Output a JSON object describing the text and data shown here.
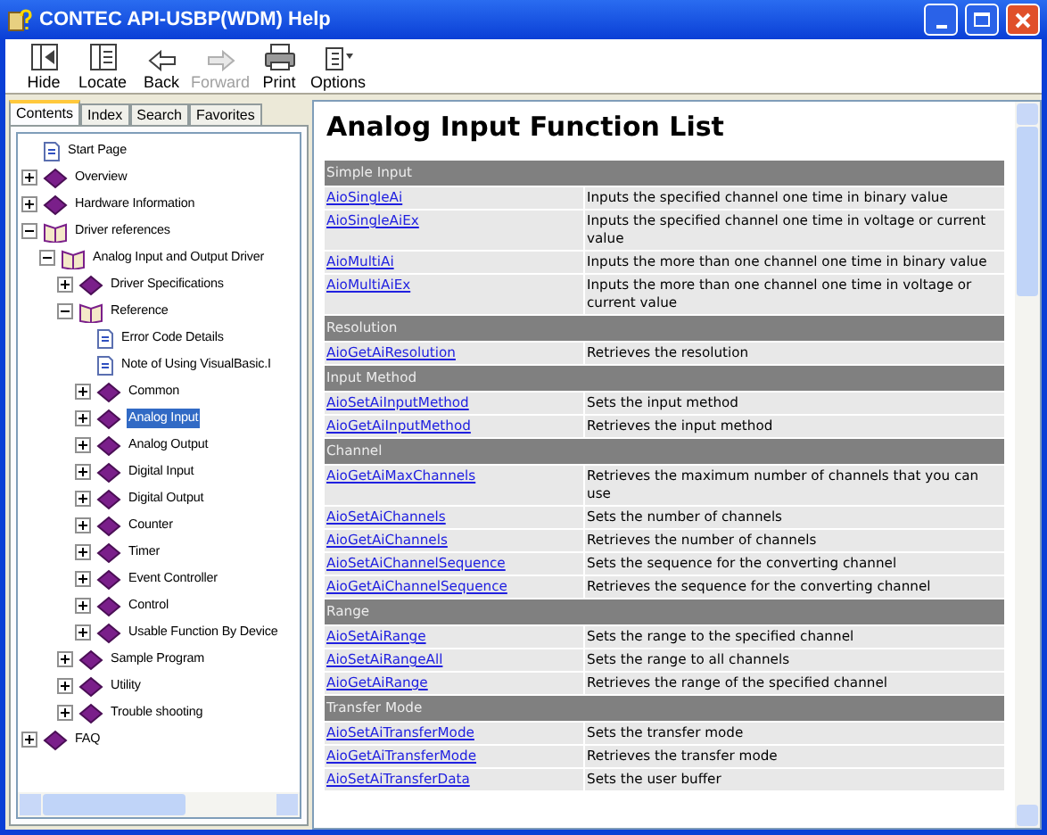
{
  "window": {
    "title": "CONTEC API-USBP(WDM) Help"
  },
  "toolbar": [
    {
      "label": "Hide",
      "kind": "hide",
      "disabled": false
    },
    {
      "label": "Locate",
      "kind": "locate",
      "disabled": false
    },
    {
      "label": "Back",
      "kind": "back",
      "disabled": false
    },
    {
      "label": "Forward",
      "kind": "forward",
      "disabled": true
    },
    {
      "label": "Print",
      "kind": "print",
      "disabled": false
    },
    {
      "label": "Options",
      "kind": "options",
      "disabled": false
    }
  ],
  "tabs": [
    {
      "label": "Contents",
      "selected": true
    },
    {
      "label": "Index",
      "selected": false
    },
    {
      "label": "Search",
      "selected": false
    },
    {
      "label": "Favorites",
      "selected": false
    }
  ],
  "tree": [
    {
      "label": "Start Page",
      "kind": "page",
      "selected": false
    },
    {
      "label": "Overview",
      "kind": "book",
      "expanded": false,
      "selected": false
    },
    {
      "label": "Hardware Information",
      "kind": "book",
      "expanded": false,
      "selected": false
    },
    {
      "label": "Driver references",
      "kind": "book",
      "expanded": true,
      "selected": false,
      "children": [
        {
          "label": "Analog Input and Output Driver",
          "kind": "book",
          "expanded": true,
          "selected": false,
          "children": [
            {
              "label": "Driver Specifications",
              "kind": "book",
              "expanded": false,
              "selected": false
            },
            {
              "label": "Reference",
              "kind": "book",
              "expanded": true,
              "selected": false,
              "children": [
                {
                  "label": "Error Code Details",
                  "kind": "page",
                  "selected": false
                },
                {
                  "label": "Note of Using VisualBasic.I",
                  "kind": "page",
                  "selected": false
                },
                {
                  "label": "Common",
                  "kind": "book",
                  "expanded": false,
                  "selected": false
                },
                {
                  "label": "Analog Input",
                  "kind": "book",
                  "expanded": false,
                  "selected": true
                },
                {
                  "label": "Analog Output",
                  "kind": "book",
                  "expanded": false,
                  "selected": false
                },
                {
                  "label": "Digital Input",
                  "kind": "book",
                  "expanded": false,
                  "selected": false
                },
                {
                  "label": "Digital Output",
                  "kind": "book",
                  "expanded": false,
                  "selected": false
                },
                {
                  "label": "Counter",
                  "kind": "book",
                  "expanded": false,
                  "selected": false
                },
                {
                  "label": "Timer",
                  "kind": "book",
                  "expanded": false,
                  "selected": false
                },
                {
                  "label": "Event Controller",
                  "kind": "book",
                  "expanded": false,
                  "selected": false
                },
                {
                  "label": "Control",
                  "kind": "book",
                  "expanded": false,
                  "selected": false
                },
                {
                  "label": "Usable Function By Device",
                  "kind": "book",
                  "expanded": false,
                  "selected": false
                }
              ]
            },
            {
              "label": "Sample Program",
              "kind": "book",
              "expanded": false,
              "selected": false
            },
            {
              "label": "Utility",
              "kind": "book",
              "expanded": false,
              "selected": false
            },
            {
              "label": "Trouble shooting",
              "kind": "book",
              "expanded": false,
              "selected": false
            }
          ]
        }
      ]
    },
    {
      "label": "FAQ",
      "kind": "book",
      "expanded": false,
      "selected": false
    }
  ],
  "page": {
    "heading": "Analog Input Function List",
    "sections": [
      {
        "title": "Simple Input",
        "rows": [
          {
            "function": "AioSingleAi",
            "description": "Inputs the specified channel one time in binary value"
          },
          {
            "function": "AioSingleAiEx",
            "description": "Inputs the specified channel one time in voltage or current value"
          },
          {
            "function": "AioMultiAi",
            "description": "Inputs the more than one channel one time in binary value"
          },
          {
            "function": "AioMultiAiEx",
            "description": "Inputs the more than one channel one time in voltage or current value"
          }
        ]
      },
      {
        "title": "Resolution",
        "rows": [
          {
            "function": "AioGetAiResolution",
            "description": "Retrieves the resolution"
          }
        ]
      },
      {
        "title": "Input Method",
        "rows": [
          {
            "function": "AioSetAiInputMethod",
            "description": "Sets the input method"
          },
          {
            "function": "AioGetAiInputMethod",
            "description": "Retrieves the input method"
          }
        ]
      },
      {
        "title": "Channel",
        "rows": [
          {
            "function": "AioGetAiMaxChannels",
            "description": "Retrieves the maximum number of channels that you can use"
          },
          {
            "function": "AioSetAiChannels",
            "description": "Sets the number of channels"
          },
          {
            "function": "AioGetAiChannels",
            "description": "Retrieves the number of channels"
          },
          {
            "function": "AioSetAiChannelSequence",
            "description": "Sets the sequence for the converting channel"
          },
          {
            "function": "AioGetAiChannelSequence",
            "description": "Retrieves the sequence for the converting channel"
          }
        ]
      },
      {
        "title": "Range",
        "rows": [
          {
            "function": "AioSetAiRange",
            "description": "Sets the range to the specified channel"
          },
          {
            "function": "AioSetAiRangeAll",
            "description": "Sets the range to all channels"
          },
          {
            "function": "AioGetAiRange",
            "description": "Retrieves the range of the specified channel"
          }
        ]
      },
      {
        "title": "Transfer Mode",
        "rows": [
          {
            "function": "AioSetAiTransferMode",
            "description": "Sets the transfer mode"
          },
          {
            "function": "AioGetAiTransferMode",
            "description": "Retrieves the transfer mode"
          },
          {
            "function": "AioSetAiTransferData",
            "description": "Sets the user buffer"
          }
        ]
      }
    ]
  }
}
